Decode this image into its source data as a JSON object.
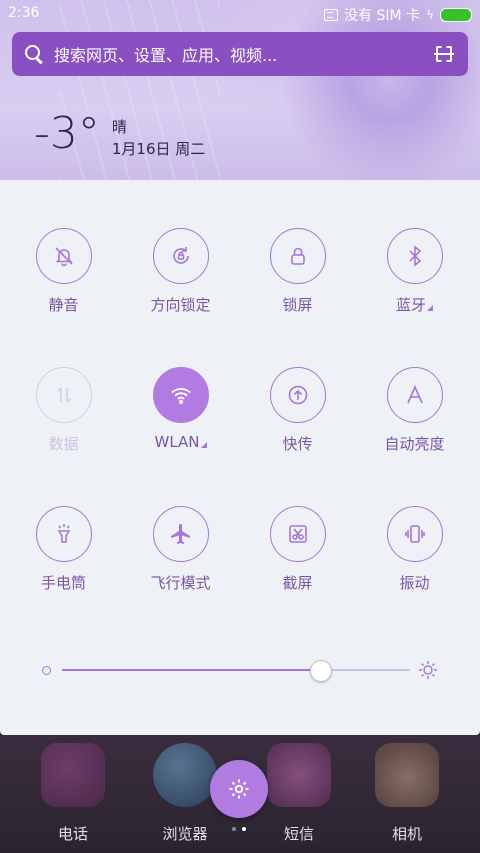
{
  "status_bar": {
    "time": "2:36",
    "sim_text": "没有 SIM 卡",
    "battery_color": "#36c12a"
  },
  "search": {
    "placeholder": "搜索网页、设置、应用、视频..."
  },
  "weather": {
    "temperature": "-3°",
    "condition": "晴",
    "date": "1月16日 周二"
  },
  "toggles": [
    {
      "label": "静音",
      "icon": "bell-mute-icon",
      "state": "off"
    },
    {
      "label": "方向锁定",
      "icon": "rotation-lock-icon",
      "state": "off"
    },
    {
      "label": "锁屏",
      "icon": "lock-icon",
      "state": "off"
    },
    {
      "label": "蓝牙",
      "icon": "bluetooth-icon",
      "state": "off",
      "has_menu": true
    },
    {
      "label": "数据",
      "icon": "data-arrows-icon",
      "state": "disabled"
    },
    {
      "label": "WLAN",
      "icon": "wifi-icon",
      "state": "on",
      "has_menu": true
    },
    {
      "label": "快传",
      "icon": "upload-circle-icon",
      "state": "off"
    },
    {
      "label": "自动亮度",
      "icon": "letter-a-icon",
      "state": "off"
    },
    {
      "label": "手电筒",
      "icon": "flashlight-icon",
      "state": "off"
    },
    {
      "label": "飞行模式",
      "icon": "airplane-icon",
      "state": "off"
    },
    {
      "label": "截屏",
      "icon": "scissors-icon",
      "state": "off"
    },
    {
      "label": "振动",
      "icon": "vibrate-icon",
      "state": "off"
    }
  ],
  "brightness": {
    "level": 0.74
  },
  "dock": {
    "apps": [
      {
        "label": "电话",
        "icon": "phone-app-icon"
      },
      {
        "label": "浏览器",
        "icon": "globe-app-icon"
      },
      {
        "label": "短信",
        "icon": "message-app-icon"
      },
      {
        "label": "相机",
        "icon": "camera-app-icon"
      }
    ],
    "settings_icon": "gear-icon",
    "page_dots": 2,
    "active_page": 1
  },
  "colors": {
    "accent": "#b27be2",
    "panel_bg": "#eef2f6",
    "search_bg": "#8a4fc0"
  }
}
